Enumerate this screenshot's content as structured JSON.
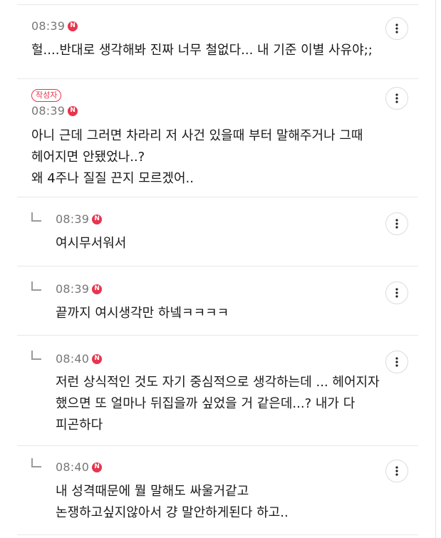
{
  "comments": [
    {
      "time": "08:39",
      "badge": "N",
      "text": "헐....반대로 생각해봐 진짜 너무 철없다... 내 기준 이별 사유야;;"
    },
    {
      "author_tag": "작성자",
      "time": "08:39",
      "badge": "N",
      "text": "아니 근데 그러면 차라리 저 사건 있을때 부터 말해주거나 그때\n헤어지면 안됐었나..?\n왜 4주나 질질 끈지 모르겠어.."
    },
    {
      "time": "08:39",
      "badge": "N",
      "text": "여시무서워서"
    },
    {
      "time": "08:39",
      "badge": "N",
      "text": "끝까지 여시생각만 하넼ㅋㅋㅋㅋ"
    },
    {
      "time": "08:40",
      "badge": "N",
      "text": "저런 상식적인 것도 자기 중심적으로 생각하는데 ... 헤어지자\n했으면 또 얼마나 뒤집을까 싶었을 거 같은데...? 내가 다\n피곤하다"
    },
    {
      "time": "08:40",
      "badge": "N",
      "text": "내 성격때문에 뭘 말해도 싸울거같고\n논쟁하고싶지않아서 걍 말안하게된다 하고.."
    }
  ]
}
